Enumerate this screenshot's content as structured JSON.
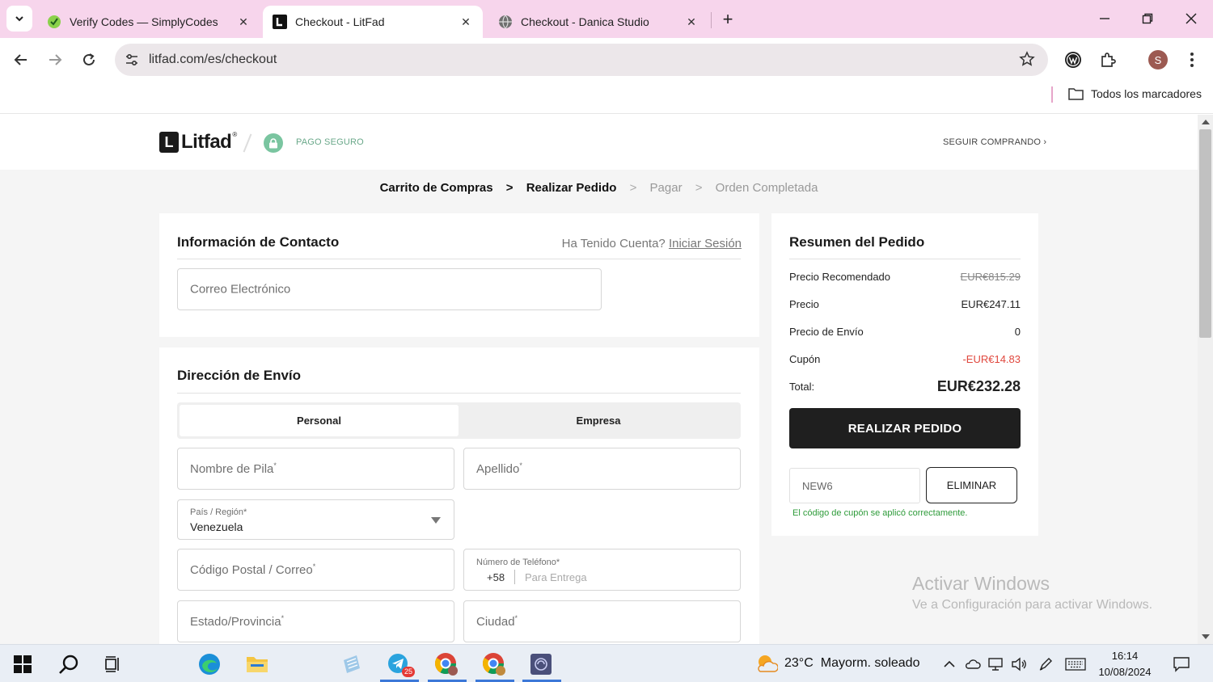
{
  "browser": {
    "tabs": [
      {
        "title": "Verify Codes — SimplyCodes",
        "active": false
      },
      {
        "title": "Checkout - LitFad",
        "active": true
      },
      {
        "title": "Checkout - Danica Studio",
        "active": false
      }
    ],
    "url": "litfad.com/es/checkout",
    "profile_initial": "S",
    "bookmarks_all_label": "Todos los marcadores",
    "colors": {
      "tabstrip": "#f7d5ec",
      "omnibox": "#ece7ea"
    }
  },
  "header": {
    "logo_letter": "L",
    "logo_text": "Litfad",
    "logo_mark": "®",
    "secure_label": "PAGO SEGURO",
    "keep_shopping_label": "SEGUIR COMPRANDO ›"
  },
  "steps": {
    "items": [
      {
        "label": "Carrito de Compras",
        "done": true
      },
      {
        "label": "Realizar Pedido",
        "done": true
      },
      {
        "label": "Pagar",
        "done": false
      },
      {
        "label": "Orden Completada",
        "done": false
      }
    ],
    "separator": ">"
  },
  "contact": {
    "title": "Información de Contacto",
    "have_account": "Ha Tenido Cuenta?",
    "login_label": "Iniciar Sesión",
    "email_placeholder": "Correo Electrónico"
  },
  "shipping": {
    "title": "Dirección de Envío",
    "tab_personal": "Personal",
    "tab_business": "Empresa",
    "first_name_placeholder": "Nombre de Pila",
    "last_name_placeholder": "Apellido",
    "required_mark": "*",
    "country_label": "País / Región*",
    "country_value": "Venezuela",
    "postal_placeholder": "Código Postal / Correo",
    "phone_label": "Número de Teléfono*",
    "phone_prefix": "+58",
    "phone_placeholder": "Para Entrega",
    "state_placeholder": "Estado/Provincia",
    "city_placeholder": "Ciudad"
  },
  "summary": {
    "title": "Resumen del Pedido",
    "recommended_label": "Precio Recomendado",
    "recommended_value": "EUR€815.29",
    "price_label": "Precio",
    "price_value": "EUR€247.11",
    "shipping_label": "Precio de Envío",
    "shipping_value": "0",
    "coupon_label": "Cupón",
    "coupon_value": "-EUR€14.83",
    "total_label": "Total:",
    "total_value": "EUR€232.28",
    "place_order_label": "REALIZAR PEDIDO",
    "coupon_code": "NEW6",
    "remove_label": "ELIMINAR",
    "coupon_success": "El código de cupón se aplicó correctamente.",
    "colors": {
      "success": "#2e9b3a",
      "discount": "#e0473d",
      "button": "#1f1f1f"
    }
  },
  "watermark": {
    "line1": "Activar Windows",
    "line2": "Ve a Configuración para activar Windows."
  },
  "taskbar": {
    "temperature": "23°C",
    "weather_text": "Mayorm. soleado",
    "telegram_badge": "25",
    "time": "16:14",
    "date": "10/08/2024"
  }
}
